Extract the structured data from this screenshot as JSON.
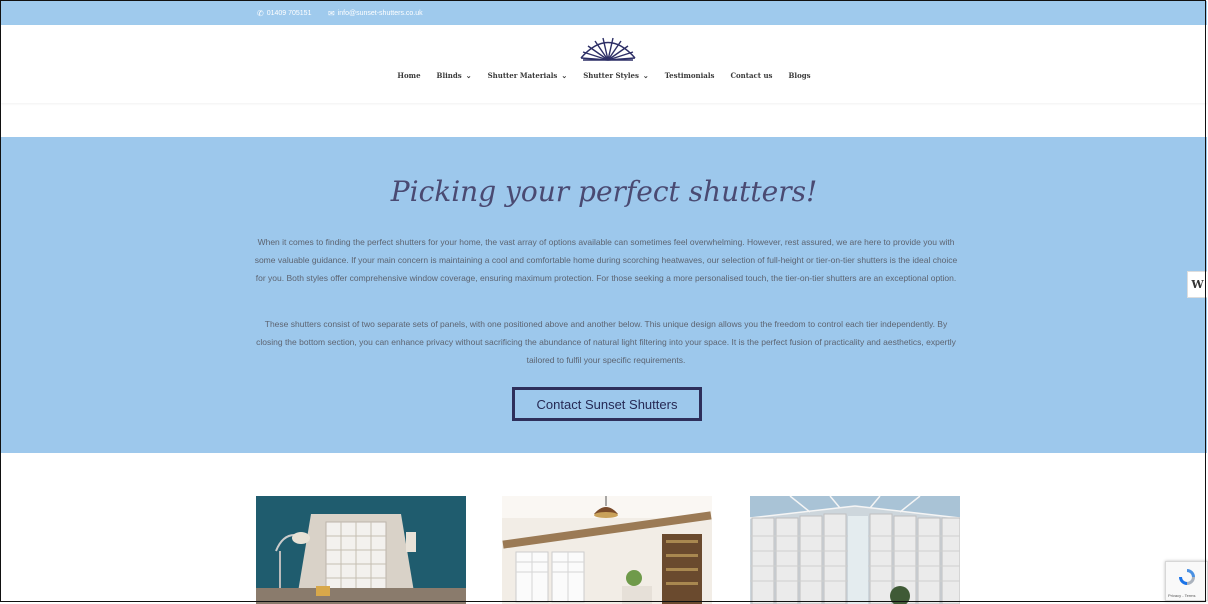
{
  "topbar": {
    "phone": "01409 705151",
    "email": "info@sunset-shutters.co.uk",
    "phone_icon": "phone-icon",
    "email_icon": "envelope-icon"
  },
  "nav": {
    "items": [
      {
        "label": "Home",
        "dropdown": false
      },
      {
        "label": "Blinds",
        "dropdown": true
      },
      {
        "label": "Shutter Materials",
        "dropdown": true
      },
      {
        "label": "Shutter Styles",
        "dropdown": true
      },
      {
        "label": "Testimonials",
        "dropdown": false
      },
      {
        "label": "Contact us",
        "dropdown": false
      },
      {
        "label": "Blogs",
        "dropdown": false
      }
    ]
  },
  "hero": {
    "title": "Picking your perfect shutters!",
    "para1": "When it comes to finding the perfect shutters for your home, the vast array of options available can sometimes feel overwhelming. However, rest assured, we are here to provide you with some valuable guidance. If your main concern is maintaining a cool and comfortable home during scorching heatwaves, our selection of full-height or tier-on-tier shutters is the ideal choice for you. Both styles offer comprehensive window coverage, ensuring maximum protection. For those seeking a more personalised touch, the tier-on-tier shutters are an exceptional option.",
    "para2": "These shutters consist of two separate sets of panels, with one positioned above and another below. This unique design allows you the freedom to control each tier independently. By closing the bottom section, you can enhance privacy without sacrificing the abundance of natural light filtering into your space. It is the perfect fusion of practicality and aesthetics, expertly tailored to fulfil your specific requirements.",
    "cta_label": "Contact Sunset Shutters"
  },
  "sidetab": {
    "label": "W"
  },
  "recaptcha": {
    "label": "Privacy - Terms"
  },
  "colors": {
    "topbar": "#9fcaed",
    "hero": "#9dc8ec",
    "cta_border": "#2e2f5b",
    "logo": "#2d2f66"
  }
}
